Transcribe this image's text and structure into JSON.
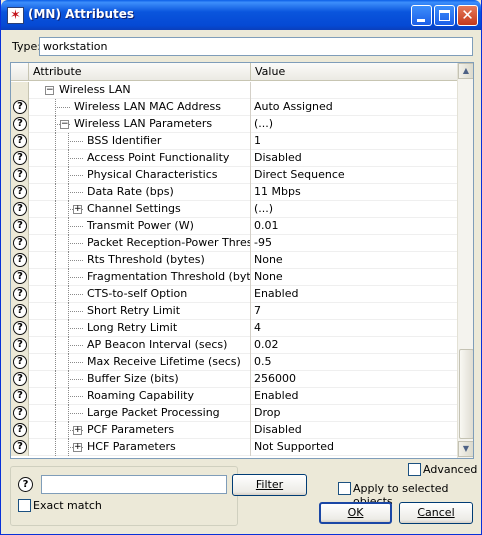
{
  "window": {
    "title": "(MN) Attributes",
    "close_glyph": "✕",
    "app_icon": "✶"
  },
  "type_field": {
    "label": "Type:",
    "value": "workstation"
  },
  "grid": {
    "columns": [
      "",
      "Attribute",
      "Value"
    ],
    "rows": [
      {
        "level": 1,
        "help": false,
        "expander": "minus",
        "attribute": "Wireless LAN",
        "value": ""
      },
      {
        "level": 2,
        "help": true,
        "expander": null,
        "attribute": "Wireless LAN MAC Address",
        "value": "Auto Assigned"
      },
      {
        "level": 2,
        "help": true,
        "expander": "minus",
        "attribute": "Wireless LAN Parameters",
        "value": "(...)"
      },
      {
        "level": 3,
        "help": true,
        "expander": null,
        "attribute": "BSS Identifier",
        "value": "1"
      },
      {
        "level": 3,
        "help": true,
        "expander": null,
        "attribute": "Access Point Functionality",
        "value": "Disabled"
      },
      {
        "level": 3,
        "help": true,
        "expander": null,
        "attribute": "Physical Characteristics",
        "value": "Direct Sequence"
      },
      {
        "level": 3,
        "help": true,
        "expander": null,
        "attribute": "Data Rate (bps)",
        "value": "11 Mbps"
      },
      {
        "level": 3,
        "help": true,
        "expander": "plus",
        "attribute": "Channel Settings",
        "value": "(...)"
      },
      {
        "level": 3,
        "help": true,
        "expander": null,
        "attribute": "Transmit Power (W)",
        "value": "0.01"
      },
      {
        "level": 3,
        "help": true,
        "expander": null,
        "attribute": "Packet Reception-Power Threshold...",
        "value": "-95"
      },
      {
        "level": 3,
        "help": true,
        "expander": null,
        "attribute": "Rts Threshold (bytes)",
        "value": "None"
      },
      {
        "level": 3,
        "help": true,
        "expander": null,
        "attribute": "Fragmentation Threshold (bytes)",
        "value": "None"
      },
      {
        "level": 3,
        "help": true,
        "expander": null,
        "attribute": "CTS-to-self Option",
        "value": "Enabled"
      },
      {
        "level": 3,
        "help": true,
        "expander": null,
        "attribute": "Short Retry Limit",
        "value": "7"
      },
      {
        "level": 3,
        "help": true,
        "expander": null,
        "attribute": "Long Retry Limit",
        "value": "4"
      },
      {
        "level": 3,
        "help": true,
        "expander": null,
        "attribute": "AP Beacon Interval (secs)",
        "value": "0.02"
      },
      {
        "level": 3,
        "help": true,
        "expander": null,
        "attribute": "Max Receive Lifetime (secs)",
        "value": "0.5"
      },
      {
        "level": 3,
        "help": true,
        "expander": null,
        "attribute": "Buffer Size (bits)",
        "value": "256000"
      },
      {
        "level": 3,
        "help": true,
        "expander": null,
        "attribute": "Roaming Capability",
        "value": "Enabled"
      },
      {
        "level": 3,
        "help": true,
        "expander": null,
        "attribute": "Large Packet Processing",
        "value": "Drop"
      },
      {
        "level": 3,
        "help": true,
        "expander": "plus",
        "attribute": "PCF Parameters",
        "value": "Disabled"
      },
      {
        "level": 3,
        "help": true,
        "expander": "plus",
        "attribute": "HCF Parameters",
        "value": "Not Supported"
      }
    ]
  },
  "icons": {
    "help": "?",
    "minus": "−",
    "plus": "+",
    "scroll_up": "▲",
    "scroll_down": "▼"
  },
  "search": {
    "value": "",
    "filter_label": "Filter",
    "exact_match_label": "Exact match",
    "exact_match_checked": false
  },
  "options": {
    "advanced_label": "Advanced",
    "advanced_checked": false,
    "apply_selected_label": "Apply to selected objects",
    "apply_selected_checked": false
  },
  "buttons": {
    "ok_label": "OK",
    "cancel_label": "Cancel"
  }
}
